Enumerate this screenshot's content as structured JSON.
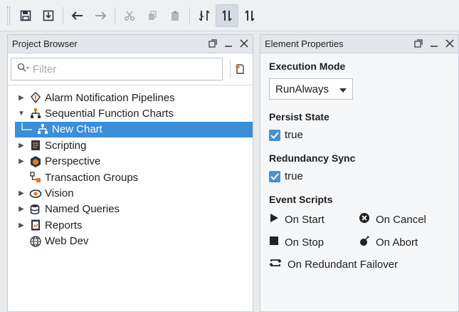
{
  "project_browser": {
    "title": "Project Browser",
    "filter_placeholder": "Filter",
    "tree": [
      {
        "label": "Alarm Notification Pipelines",
        "icon": "alarm-pipeline-icon",
        "expanded": false
      },
      {
        "label": "Sequential Function Charts",
        "icon": "sfc-icon",
        "expanded": true
      },
      {
        "label": "New Chart",
        "icon": "chart-node-icon",
        "selected": true
      },
      {
        "label": "Scripting",
        "icon": "scripting-icon",
        "expanded": false
      },
      {
        "label": "Perspective",
        "icon": "perspective-icon",
        "expanded": false
      },
      {
        "label": "Transaction Groups",
        "icon": "transaction-groups-icon"
      },
      {
        "label": "Vision",
        "icon": "vision-icon",
        "expanded": false
      },
      {
        "label": "Named Queries",
        "icon": "named-queries-icon",
        "expanded": false
      },
      {
        "label": "Reports",
        "icon": "reports-icon",
        "expanded": false
      },
      {
        "label": "Web Dev",
        "icon": "web-dev-icon"
      }
    ]
  },
  "element_properties": {
    "title": "Element Properties",
    "execution_mode": {
      "label": "Execution Mode",
      "value": "RunAlways"
    },
    "persist_state": {
      "label": "Persist State",
      "value": "true",
      "checked": true
    },
    "redundancy_sync": {
      "label": "Redundancy Sync",
      "value": "true",
      "checked": true
    },
    "event_scripts": {
      "label": "Event Scripts",
      "items": [
        "On Start",
        "On Cancel",
        "On Stop",
        "On Abort",
        "On Redundant Failover"
      ]
    }
  },
  "colors": {
    "selection": "#3b8ed8",
    "checkbox": "#4a90d4",
    "accent_orange": "#e07a1f"
  }
}
